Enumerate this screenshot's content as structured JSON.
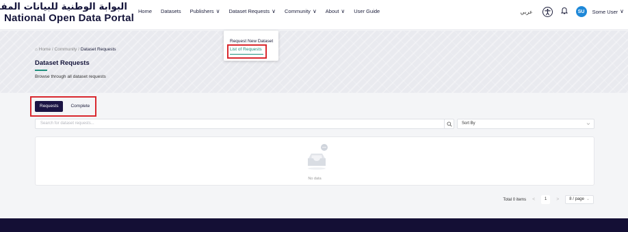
{
  "header": {
    "logo_ar": "البوابة الوطنية للبيانات المفتوحة",
    "logo_en": "National Open Data Portal",
    "nav": [
      {
        "label": "Home",
        "dropdown": false
      },
      {
        "label": "Datasets",
        "dropdown": false
      },
      {
        "label": "Publishers",
        "dropdown": true
      },
      {
        "label": "Dataset Requests",
        "dropdown": true
      },
      {
        "label": "Community",
        "dropdown": true
      },
      {
        "label": "About",
        "dropdown": true
      },
      {
        "label": "User Guide",
        "dropdown": false
      }
    ],
    "chevron": "∨",
    "lang_switch": "عربي",
    "avatar_initials": "SU",
    "user_name": "Some User",
    "avatar_color": "#1e88d8"
  },
  "dropdown": {
    "items": [
      "Request New Dataset",
      "List of Requests"
    ],
    "active_index": 1
  },
  "hero": {
    "breadcrumb": [
      "Home",
      "Community",
      "Dataset Requests"
    ],
    "breadcrumb_sep": "/",
    "title": "Dataset Requests",
    "subtitle": "Browse through all dataset requests"
  },
  "tabs": [
    "Requests",
    "Complete"
  ],
  "search": {
    "placeholder": "Search for dataset requests...",
    "sort_label": "Sort By"
  },
  "empty": {
    "text": "No data"
  },
  "pagination": {
    "total": "Total 0 items",
    "prev": "<",
    "page": "1",
    "next": ">",
    "page_size": "8 / page"
  },
  "colors": {
    "accent": "#1e8f7c",
    "primary": "#1b1444",
    "highlight": "#d9262c"
  }
}
